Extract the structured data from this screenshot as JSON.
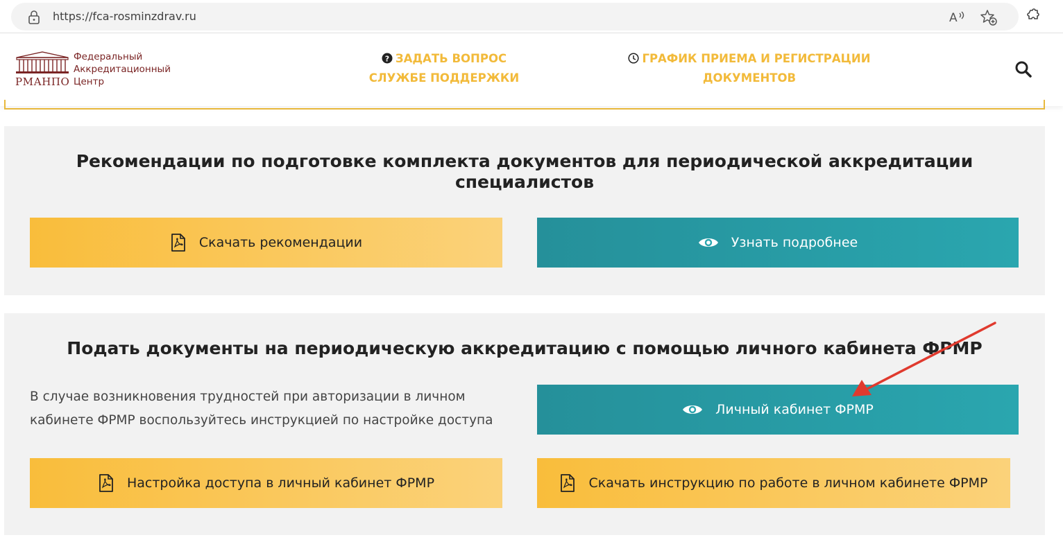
{
  "browser": {
    "url": "https://fca-rosminzdrav.ru"
  },
  "header": {
    "logo_abbr": "РМАНПО",
    "logo_line1": "Федеральный",
    "logo_line2": "Аккредитационный",
    "logo_line3": "Центр",
    "nav_ask_line1": "ЗАДАТЬ ВОПРОС",
    "nav_ask_line2": "СЛУЖБЕ ПОДДЕРЖКИ",
    "nav_schedule_line1": "ГРАФИК ПРИЕМА И РЕГИСТРАЦИИ",
    "nav_schedule_line2": "ДОКУМЕНТОВ"
  },
  "section1": {
    "title": "Рекомендации по подготовке комплекта документов для периодической аккредитации специалистов",
    "download_label": "Скачать рекомендации",
    "more_label": "Узнать подробнее"
  },
  "section2": {
    "title": "Подать документы на периодическую аккредитацию с помощью личного кабинета ФРМР",
    "info_text": "В случае возникновения трудностей при авторизации в личном кабинете ФРМР воспользуйтесь инструкцией по настройке доступа",
    "cabinet_label": "Личный кабинет ФРМР",
    "access_label": "Настройка доступа в личный кабинет ФРМР",
    "instruction_label": "Скачать инструкцию по работе в личном кабинете ФРМР"
  },
  "colors": {
    "accent_yellow": "#f9bd3b",
    "accent_teal": "#2aa6af",
    "logo_brown": "#7a2424",
    "annotation_red": "#e03a2e"
  }
}
